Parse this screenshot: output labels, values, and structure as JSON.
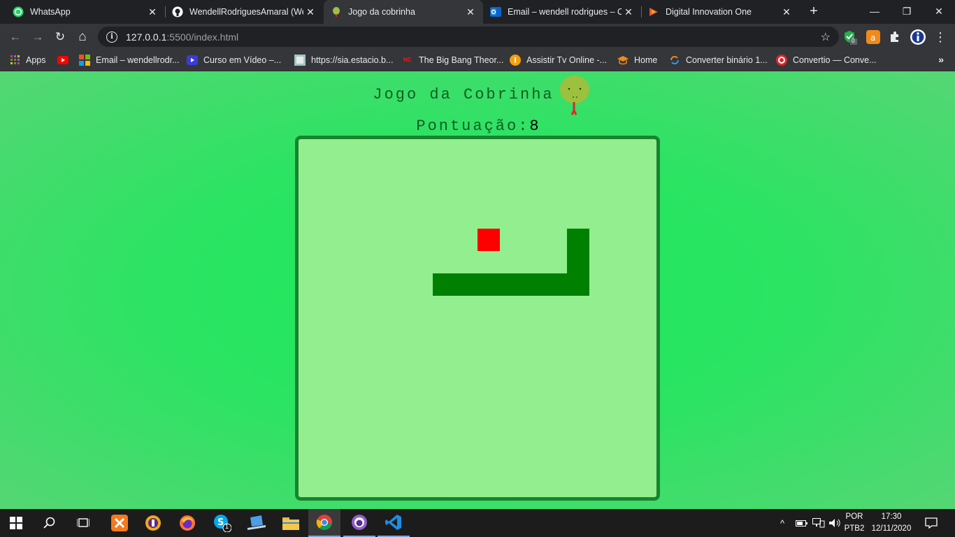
{
  "browser": {
    "tabs": [
      {
        "title": "WhatsApp",
        "icon": "whatsapp-icon",
        "active": false
      },
      {
        "title": "WendellRodriguesAmaral (Wen",
        "icon": "github-icon",
        "active": false
      },
      {
        "title": "Jogo da cobrinha",
        "icon": "snake-icon",
        "active": true
      },
      {
        "title": "Email – wendell rodrigues – Ou",
        "icon": "outlook-icon",
        "active": false
      },
      {
        "title": "Digital Innovation One",
        "icon": "dio-icon",
        "active": false
      }
    ],
    "tab_close_glyph": "✕",
    "new_tab_glyph": "+",
    "window_controls": {
      "minimize": "—",
      "maximize": "❐",
      "close": "✕"
    },
    "address": {
      "host": "127.0.0.1",
      "path": ":5500/index.html"
    },
    "nav": {
      "back": "←",
      "forward": "→",
      "reload": "↻",
      "home": "⌂"
    },
    "star_glyph": "☆",
    "extension_badge": "0",
    "bookmarks": [
      {
        "label": "Apps",
        "icon": "apps-grid-icon"
      },
      {
        "label": "",
        "icon": "youtube-icon"
      },
      {
        "label": "Email – wendellrodr...",
        "icon": "microsoft-icon"
      },
      {
        "label": "Curso em Vídeo –...",
        "icon": "curso-em-video-icon"
      },
      {
        "label": "https://sia.estacio.b...",
        "icon": "estacio-icon"
      },
      {
        "label": "The Big Bang Theor...",
        "icon": "nc-icon"
      },
      {
        "label": "Assistir Tv Online -...",
        "icon": "tv-online-icon"
      },
      {
        "label": "Home",
        "icon": "graduation-cap-icon"
      },
      {
        "label": "Converter binário 1...",
        "icon": "converter-icon"
      },
      {
        "label": "Convertio — Conve...",
        "icon": "convertio-icon"
      }
    ],
    "bookmarks_more": "»"
  },
  "game": {
    "title": "Jogo da Cobrinha",
    "score_label": "Pontuação:",
    "score_value": "8",
    "grid_size": 16,
    "snake_cells": [
      [
        6,
        6
      ],
      [
        7,
        6
      ],
      [
        8,
        6
      ],
      [
        9,
        6
      ],
      [
        10,
        6
      ],
      [
        11,
        6
      ],
      [
        12,
        6
      ],
      [
        12,
        5
      ],
      [
        12,
        4
      ]
    ],
    "food_cell": [
      8,
      4
    ],
    "colors": {
      "snake": "#008000",
      "food": "#ff0000",
      "board": "#92ee8e",
      "board_border": "#19832f",
      "page_bg": "#2ae462"
    }
  },
  "taskbar": {
    "apps": [
      "windows-start-icon",
      "search-icon",
      "task-view-icon",
      "xampp-icon",
      "avast-secure-browser-icon",
      "firefox-icon",
      "skype-icon",
      "laptop-app-icon",
      "file-explorer-icon",
      "chrome-icon",
      "github-desktop-icon",
      "vscode-icon"
    ],
    "skype_badge": "1",
    "lang_top": "POR",
    "lang_bottom": "PTB2",
    "time": "17:30",
    "date": "12/11/2020",
    "tray_up": "^"
  }
}
